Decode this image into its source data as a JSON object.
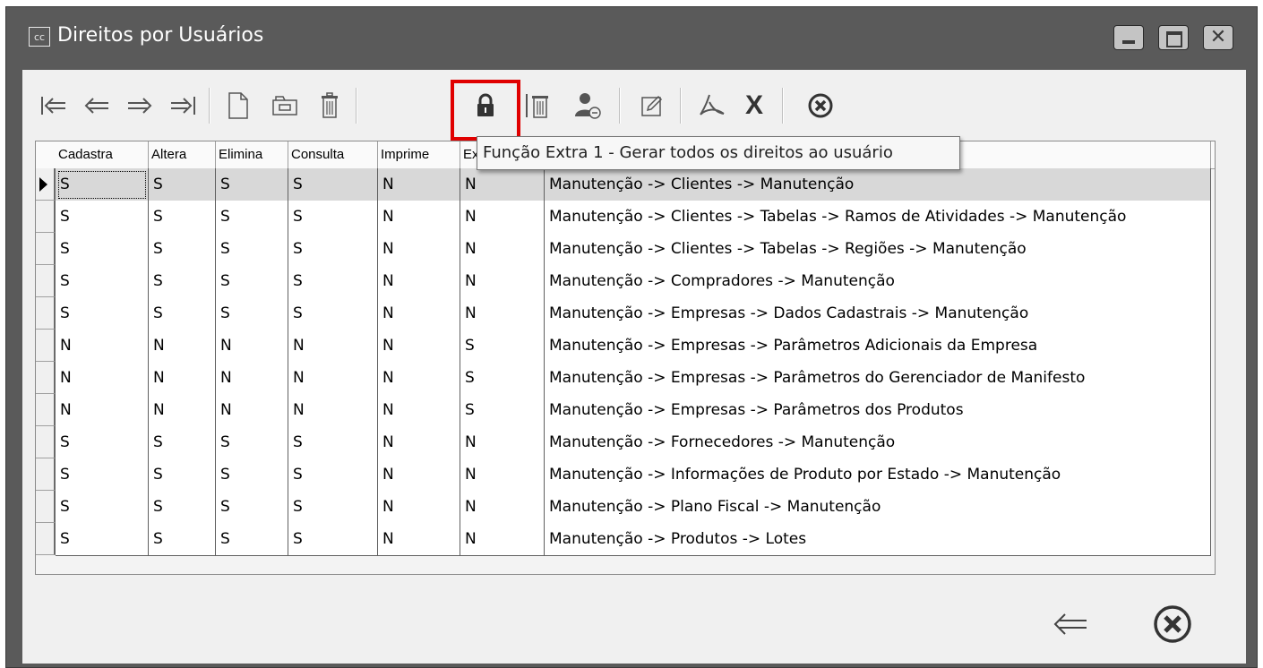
{
  "window": {
    "icon_text": "cc",
    "title": "Direitos por Usuários"
  },
  "tooltip": "Função Extra 1 - Gerar todos os direitos ao usuário",
  "grid": {
    "columns": [
      "Cadastra",
      "Altera",
      "Elimina",
      "Consulta",
      "Imprime",
      "Ex",
      ""
    ],
    "rows": [
      [
        "S",
        "S",
        "S",
        "S",
        "N",
        "N",
        "Manutenção -> Clientes -> Manutenção"
      ],
      [
        "S",
        "S",
        "S",
        "S",
        "N",
        "N",
        "Manutenção -> Clientes -> Tabelas -> Ramos de Atividades -> Manutenção"
      ],
      [
        "S",
        "S",
        "S",
        "S",
        "N",
        "N",
        "Manutenção -> Clientes -> Tabelas -> Regiões -> Manutenção"
      ],
      [
        "S",
        "S",
        "S",
        "S",
        "N",
        "N",
        "Manutenção -> Compradores -> Manutenção"
      ],
      [
        "S",
        "S",
        "S",
        "S",
        "N",
        "N",
        "Manutenção -> Empresas -> Dados Cadastrais -> Manutenção"
      ],
      [
        "N",
        "N",
        "N",
        "N",
        "N",
        "S",
        "Manutenção -> Empresas -> Parâmetros Adicionais da Empresa"
      ],
      [
        "N",
        "N",
        "N",
        "N",
        "N",
        "S",
        "Manutenção -> Empresas -> Parâmetros do Gerenciador de Manifesto"
      ],
      [
        "N",
        "N",
        "N",
        "N",
        "N",
        "S",
        "Manutenção -> Empresas -> Parâmetros dos Produtos"
      ],
      [
        "S",
        "S",
        "S",
        "S",
        "N",
        "N",
        "Manutenção -> Fornecedores -> Manutenção"
      ],
      [
        "S",
        "S",
        "S",
        "S",
        "N",
        "N",
        "Manutenção -> Informações de Produto por Estado -> Manutenção"
      ],
      [
        "S",
        "S",
        "S",
        "S",
        "N",
        "N",
        "Manutenção -> Plano Fiscal -> Manutenção"
      ],
      [
        "S",
        "S",
        "S",
        "S",
        "N",
        "N",
        "Manutenção -> Produtos -> Lotes"
      ]
    ],
    "selected_row": 0
  },
  "toolbar_icons": [
    "first-record-icon",
    "previous-record-icon",
    "next-record-icon",
    "last-record-icon",
    "new-document-icon",
    "open-folder-icon",
    "trash-icon",
    "lock-icon",
    "delete-column-icon",
    "user-remove-icon",
    "edit-icon",
    "pdf-icon",
    "excel-icon",
    "cancel-icon"
  ],
  "colors": {
    "highlight": "#e00000",
    "window_frame": "#5a5a5a",
    "selected_row": "#d8d8d8"
  }
}
